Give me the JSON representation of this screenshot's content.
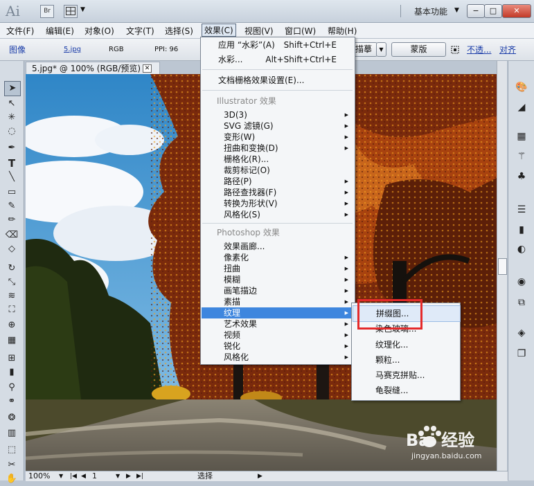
{
  "titlebar": {
    "logo": "Ai",
    "bridge": "Br",
    "workspace": "基本功能",
    "controls": [
      "−",
      "□",
      "✕"
    ]
  },
  "menubar": {
    "items": [
      "文件(F)",
      "编辑(E)",
      "对象(O)",
      "文字(T)",
      "选择(S)",
      "效果(C)",
      "视图(V)",
      "窗口(W)",
      "帮助(H)"
    ]
  },
  "control_bar": {
    "image_label": "图像",
    "file_name": "5.jpg",
    "color_mode": "RGB",
    "ppi": "PPI: 96",
    "trace_button": "描摹",
    "mask_button": "蒙版",
    "opacity_link": "不透...",
    "align_link": "对齐"
  },
  "document": {
    "tab_title": "5.jpg* @ 100% (RGB/预览)",
    "close": "✕"
  },
  "statusbar": {
    "zoom": "100%",
    "page": "1",
    "tool_status": "选择"
  },
  "effect_menu": {
    "apply_last_label": "应用 “水彩”(A)",
    "apply_last_shortcut": "Shift+Ctrl+E",
    "last_effect_label": "水彩...",
    "last_effect_shortcut": "Alt+Shift+Ctrl+E",
    "raster_settings": "文档栅格效果设置(E)...",
    "illustrator_header": "Illustrator 效果",
    "illustrator_items": [
      "3D(3)",
      "SVG 滤镜(G)",
      "变形(W)",
      "扭曲和变换(D)",
      "栅格化(R)...",
      "裁剪标记(O)",
      "路径(P)",
      "路径查找器(F)",
      "转换为形状(V)",
      "风格化(S)"
    ],
    "photoshop_header": "Photoshop 效果",
    "photoshop_items": [
      "效果画廊...",
      "像素化",
      "扭曲",
      "模糊",
      "画笔描边",
      "素描",
      "纹理",
      "艺术效果",
      "视频",
      "锐化",
      "风格化"
    ]
  },
  "texture_menu": {
    "items": [
      "拼缀图...",
      "染色玻璃...",
      "纹理化...",
      "颗粒...",
      "马赛克拼贴...",
      "龟裂缝..."
    ]
  },
  "watermark": {
    "brand": "Bai  经验",
    "url": "jingyan.baidu.com"
  }
}
